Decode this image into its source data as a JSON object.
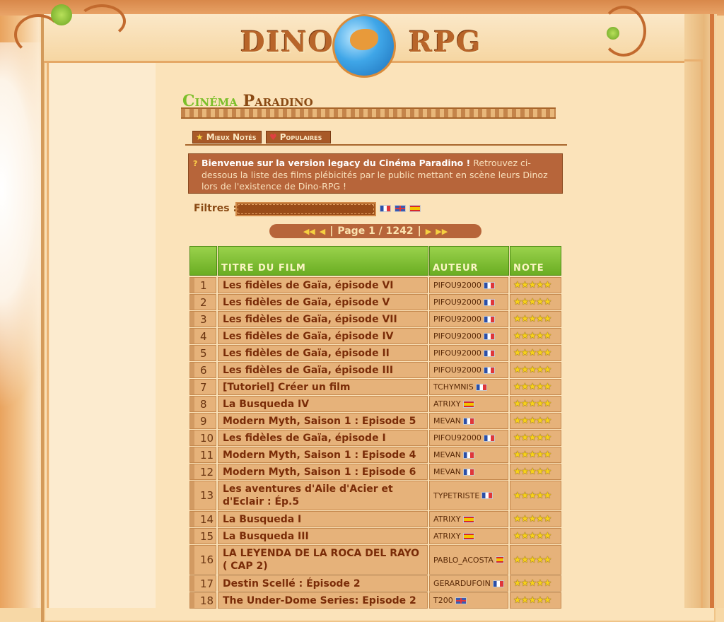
{
  "logo": {
    "left": "DINO",
    "right": "RPG"
  },
  "title": {
    "part1": "Cinéma",
    "part2": "Paradino"
  },
  "tabs": [
    {
      "label": "Mieux Notés",
      "icon": "star-icon"
    },
    {
      "label": "Populaires",
      "icon": "heart-icon"
    }
  ],
  "info": {
    "bold": "Bienvenue sur la version legacy du Cinéma Paradino !",
    "text": "Retrouvez ci-dessous la liste des films plébicités par le public mettant en scène leurs Dinoz lors de l'existence de Dino-RPG !"
  },
  "filters": {
    "label": "Filtres :",
    "value": "",
    "flags": [
      "fr",
      "en",
      "es"
    ]
  },
  "pager": {
    "text": "Page 1 / 1242"
  },
  "table": {
    "headers": [
      "",
      "TITRE DU FILM",
      "AUTEUR",
      "NOTE"
    ],
    "rows": [
      {
        "num": "1",
        "title": "Les fidèles de Gaïa, épisode VI",
        "author": "PIFOU92000",
        "flag": "fr",
        "stars": 5
      },
      {
        "num": "2",
        "title": "Les fidèles de Gaïa, épisode V",
        "author": "PIFOU92000",
        "flag": "fr",
        "stars": 5
      },
      {
        "num": "3",
        "title": "Les fidèles de Gaïa, épisode VII",
        "author": "PIFOU92000",
        "flag": "fr",
        "stars": 5
      },
      {
        "num": "4",
        "title": "Les fidèles de Gaïa, épisode IV",
        "author": "PIFOU92000",
        "flag": "fr",
        "stars": 5
      },
      {
        "num": "5",
        "title": "Les fidèles de Gaïa, épisode II",
        "author": "PIFOU92000",
        "flag": "fr",
        "stars": 5
      },
      {
        "num": "6",
        "title": "Les fidèles de Gaïa, épisode III",
        "author": "PIFOU92000",
        "flag": "fr",
        "stars": 5
      },
      {
        "num": "7",
        "title": "[Tutoriel] Créer un film",
        "author": "TCHYMNIS",
        "flag": "fr",
        "stars": 5
      },
      {
        "num": "8",
        "title": "La Busqueda IV",
        "author": "ATRIXY",
        "flag": "es",
        "stars": 5
      },
      {
        "num": "9",
        "title": "Modern Myth, Saison 1 : Episode 5",
        "author": "MEVAN",
        "flag": "fr",
        "stars": 5
      },
      {
        "num": "10",
        "title": "Les fidèles de Gaïa, épisode I",
        "author": "PIFOU92000",
        "flag": "fr",
        "stars": 5
      },
      {
        "num": "11",
        "title": "Modern Myth, Saison 1 : Episode 4",
        "author": "MEVAN",
        "flag": "fr",
        "stars": 5
      },
      {
        "num": "12",
        "title": "Modern Myth, Saison 1 : Episode 6",
        "author": "MEVAN",
        "flag": "fr",
        "stars": 5
      },
      {
        "num": "13",
        "title": "Les aventures d'Aile d'Acier et d'Eclair : Ép.5",
        "author": "TYPETRISTE",
        "flag": "fr",
        "stars": 5,
        "tall": true
      },
      {
        "num": "14",
        "title": "La Busqueda I",
        "author": "ATRIXY",
        "flag": "es",
        "stars": 5
      },
      {
        "num": "15",
        "title": "La Busqueda III",
        "author": "ATRIXY",
        "flag": "es",
        "stars": 5
      },
      {
        "num": "16",
        "title": "LA LEYENDA DE LA ROCA DEL RAYO ( CAP 2)",
        "author": "PABLO_ACOSTA",
        "flag": "es",
        "stars": 5,
        "tall": true
      },
      {
        "num": "17",
        "title": "Destin Scellé : Épisode 2",
        "author": "GERARDUFOIN",
        "flag": "fr",
        "stars": 5
      },
      {
        "num": "18",
        "title": "The Under-Dome Series: Episode 2",
        "author": "T200",
        "flag": "en",
        "stars": 5
      }
    ]
  }
}
